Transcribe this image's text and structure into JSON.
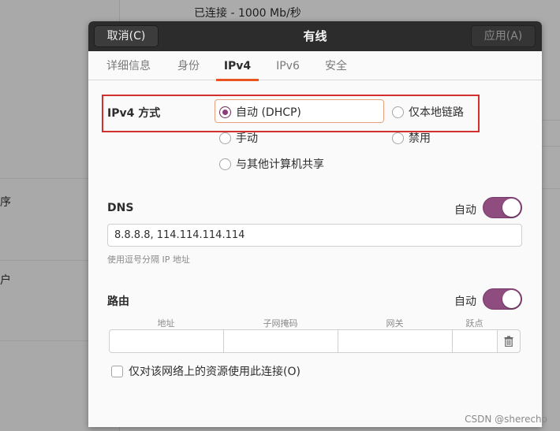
{
  "background": {
    "connection_status": "已连接 - 1000 Mb/秒",
    "left_fragments": [
      "序",
      "户"
    ]
  },
  "dialog": {
    "title": "有线",
    "cancel_label": "取消(C)",
    "apply_label": "应用(A)"
  },
  "tabs": [
    {
      "label": "详细信息"
    },
    {
      "label": "身份"
    },
    {
      "label": "IPv4"
    },
    {
      "label": "IPv6"
    },
    {
      "label": "安全"
    }
  ],
  "ipv4": {
    "method_label": "IPv4 方式",
    "methods": [
      {
        "label": "自动 (DHCP)",
        "selected": true
      },
      {
        "label": "仅本地链路",
        "selected": false
      },
      {
        "label": "手动",
        "selected": false
      },
      {
        "label": "禁用",
        "selected": false
      },
      {
        "label": "与其他计算机共享",
        "selected": false
      }
    ]
  },
  "dns": {
    "label": "DNS",
    "auto_label": "自动",
    "auto_on": true,
    "value": "8.8.8.8, 114.114.114.114",
    "hint": "使用逗号分隔 IP 地址"
  },
  "routes": {
    "label": "路由",
    "auto_label": "自动",
    "auto_on": true,
    "columns": [
      "地址",
      "子网掩码",
      "网关",
      "跃点"
    ],
    "rows": [
      [
        "",
        "",
        "",
        ""
      ]
    ]
  },
  "only_local_resources": {
    "label": "仅对该网络上的资源使用此连接(O)",
    "checked": false
  },
  "watermark": "CSDN @sherecho",
  "colors": {
    "accent": "#e95420",
    "toggle": "#8f4d7f",
    "highlight_box": "#d32f2f"
  }
}
